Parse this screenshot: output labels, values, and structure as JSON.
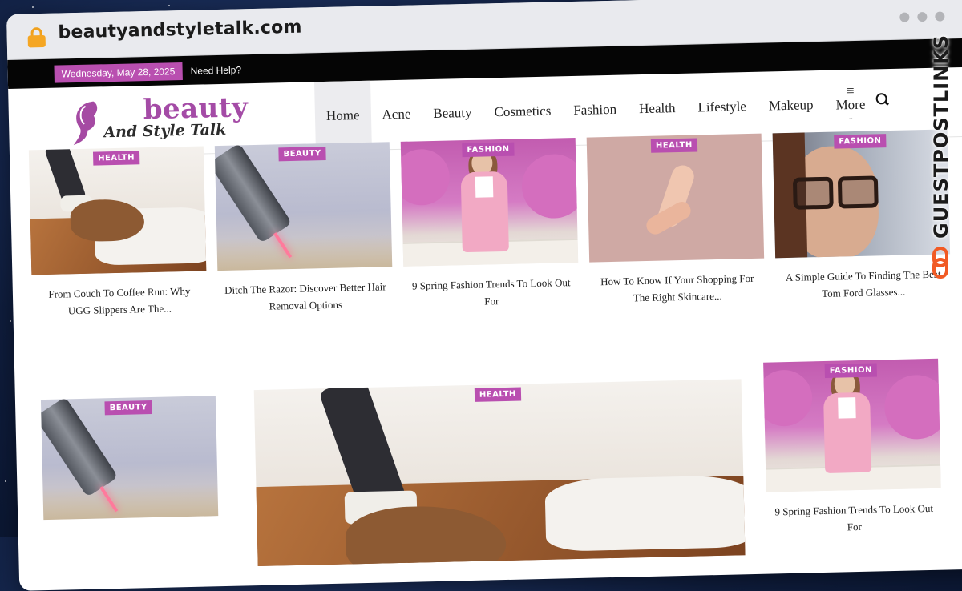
{
  "browser": {
    "url": "beautyandstyletalk.com"
  },
  "topbar": {
    "date": "Wednesday, May 28, 2025",
    "help": "Need Help?"
  },
  "logo": {
    "line1": "beauty",
    "line2": "And Style Talk"
  },
  "nav": {
    "items": [
      "Home",
      "Acne",
      "Beauty",
      "Cosmetics",
      "Fashion",
      "Health",
      "Lifestyle",
      "Makeup"
    ],
    "more_label": "More",
    "active": "Home"
  },
  "row1": [
    {
      "category": "HEALTH",
      "title": "From Couch To Coffee Run: Why UGG Slippers Are The...",
      "image": "slippers"
    },
    {
      "category": "BEAUTY",
      "title": "Ditch The Razor: Discover Better Hair Removal Options",
      "image": "laser"
    },
    {
      "category": "FASHION",
      "title": "9 Spring Fashion Trends To Look Out For",
      "image": "flowers"
    },
    {
      "category": "HEALTH",
      "title": "How To Know If Your Shopping For The Right Skincare...",
      "image": "hand"
    },
    {
      "category": "FASHION",
      "title": "A Simple Guide To Finding The Best Tom Ford Glasses...",
      "image": "glasses"
    }
  ],
  "row2": [
    {
      "category": "BEAUTY",
      "title": "",
      "image": "laser"
    },
    {
      "category": "HEALTH",
      "title": "",
      "image": "slippers"
    },
    {
      "category": "FASHION",
      "title": "9 Spring Fashion Trends To Look Out For",
      "image": "flowers"
    }
  ],
  "watermark": {
    "text": "GUESTPOSTLINKS"
  },
  "colors": {
    "accent": "#b94fb0",
    "topbar": "#050505"
  }
}
